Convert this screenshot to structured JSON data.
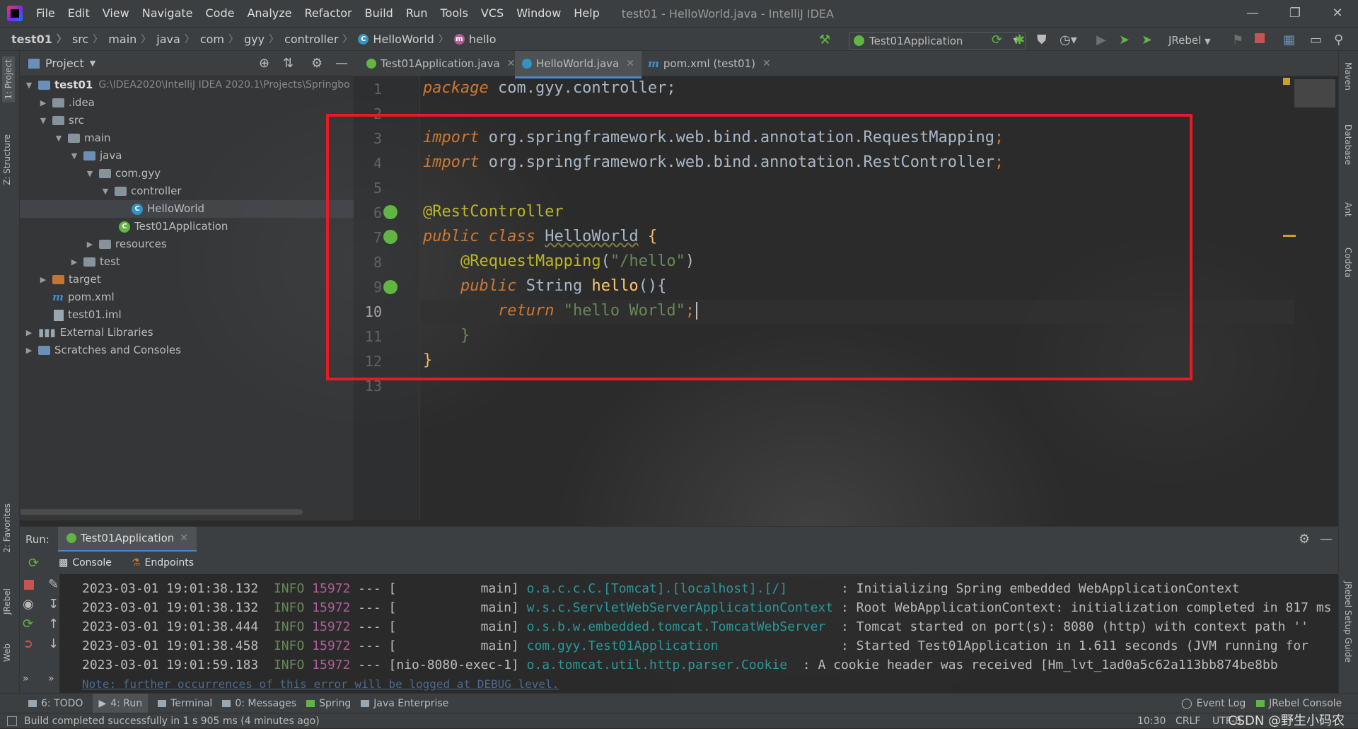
{
  "app": {
    "window_title": "test01 - HelloWorld.java - IntelliJ IDEA",
    "menu": [
      "File",
      "Edit",
      "View",
      "Navigate",
      "Code",
      "Analyze",
      "Refactor",
      "Build",
      "Run",
      "Tools",
      "VCS",
      "Window",
      "Help"
    ]
  },
  "breadcrumb": [
    "test01",
    "src",
    "main",
    "java",
    "com",
    "gyy",
    "controller",
    "HelloWorld",
    "hello"
  ],
  "toolbar": {
    "run_config": "Test01Application",
    "jrebel": "JRebel"
  },
  "left_strip": {
    "project": "1: Project",
    "structure": "Z: Structure",
    "favorites": "2: Favorites",
    "jrebel": "JRebel",
    "web": "Web"
  },
  "right_strip": {
    "maven": "Maven",
    "database": "Database",
    "ant": "Ant",
    "codota": "Codota",
    "jrebel_guide": "JRebel Setup Guide"
  },
  "project": {
    "title": "Project",
    "root_name": "test01",
    "root_path": "G:\\IDEA2020\\IntelliJ IDEA 2020.1\\Projects\\Springbo",
    "items": [
      ".idea",
      "src",
      "main",
      "java",
      "com.gyy",
      "controller",
      "HelloWorld",
      "Test01Application",
      "resources",
      "test",
      "target",
      "pom.xml",
      "test01.iml",
      "External Libraries",
      "Scratches and Consoles"
    ]
  },
  "editor": {
    "tabs": [
      "Test01Application.java",
      "HelloWorld.java",
      "pom.xml (test01)"
    ],
    "line_numbers": [
      "1",
      "2",
      "3",
      "4",
      "5",
      "6",
      "7",
      "8",
      "9",
      "10",
      "11",
      "12",
      "13"
    ],
    "code": {
      "l1_kw": "package",
      "l1_rest": " com.gyy.controller;",
      "l3_kw": "import",
      "l3_pkg": " org.springframework.web.bind.annotation.",
      "l3_cls": "RequestMapping",
      "l4_kw": "import",
      "l4_pkg": " org.springframework.web.bind.annotation.",
      "l4_cls": "RestController",
      "l6_ann": "@RestController",
      "l7_kw": "public class",
      "l7_name": "HelloWorld",
      "l7_brace": "{",
      "l8_ann": "@RequestMapping",
      "l8_open": "(",
      "l8_str": "\"/hello\"",
      "l8_close": ")",
      "l9_kw": "public",
      "l9_type": "String",
      "l9_name": "hello",
      "l9_rest": "(){",
      "l10_kw": "return",
      "l10_str": "\"hello World\"",
      "l10_semi": ";",
      "l11": "}",
      "l12": "}"
    }
  },
  "run": {
    "label": "Run:",
    "tab": "Test01Application",
    "console_tab": "Console",
    "endpoints_tab": "Endpoints",
    "logs": [
      {
        "ts": "2023-03-01 19:01:38.132",
        "lvl": "INFO",
        "pid": "15972",
        "sep": "---",
        "thread": "[           main]",
        "logger": "o.a.c.c.C.[Tomcat].[localhost].[/]",
        "msg": ": Initializing Spring embedded WebApplicationContext"
      },
      {
        "ts": "2023-03-01 19:01:38.132",
        "lvl": "INFO",
        "pid": "15972",
        "sep": "---",
        "thread": "[           main]",
        "logger": "w.s.c.ServletWebServerApplicationContext",
        "msg": ": Root WebApplicationContext: initialization completed in 817 ms"
      },
      {
        "ts": "2023-03-01 19:01:38.444",
        "lvl": "INFO",
        "pid": "15972",
        "sep": "---",
        "thread": "[           main]",
        "logger": "o.s.b.w.embedded.tomcat.TomcatWebServer",
        "msg": ": Tomcat started on port(s): 8080 (http) with context path ''"
      },
      {
        "ts": "2023-03-01 19:01:38.458",
        "lvl": "INFO",
        "pid": "15972",
        "sep": "---",
        "thread": "[           main]",
        "logger": "com.gyy.Test01Application",
        "msg": ": Started Test01Application in 1.611 seconds (JVM running for"
      },
      {
        "ts": "2023-03-01 19:01:59.183",
        "lvl": "INFO",
        "pid": "15972",
        "sep": "---",
        "thread": "[nio-8080-exec-1]",
        "logger": "o.a.tomcat.util.http.parser.Cookie",
        "msg": ": A cookie header was received [Hm_lvt_1ad0a5c62a113bb874be8bb"
      }
    ],
    "note": "Note: further occurrences of this error will be logged at DEBUG level."
  },
  "tool_windows": [
    "6: TODO",
    "4: Run",
    "Terminal",
    "0: Messages",
    "Spring",
    "Java Enterprise"
  ],
  "tool_windows_right": [
    "Event Log",
    "JRebel Console"
  ],
  "status": {
    "message": "Build completed successfully in 1 s 905 ms (4 minutes ago)",
    "position": "10:30",
    "line_sep": "CRLF",
    "encoding": "UTF-8",
    "watermark": "CSDN @野生小码农"
  },
  "colors": {
    "highlight_box": "#e81a24",
    "keyword": "#cc7832",
    "annotation": "#bbb529",
    "string": "#6a8759"
  }
}
